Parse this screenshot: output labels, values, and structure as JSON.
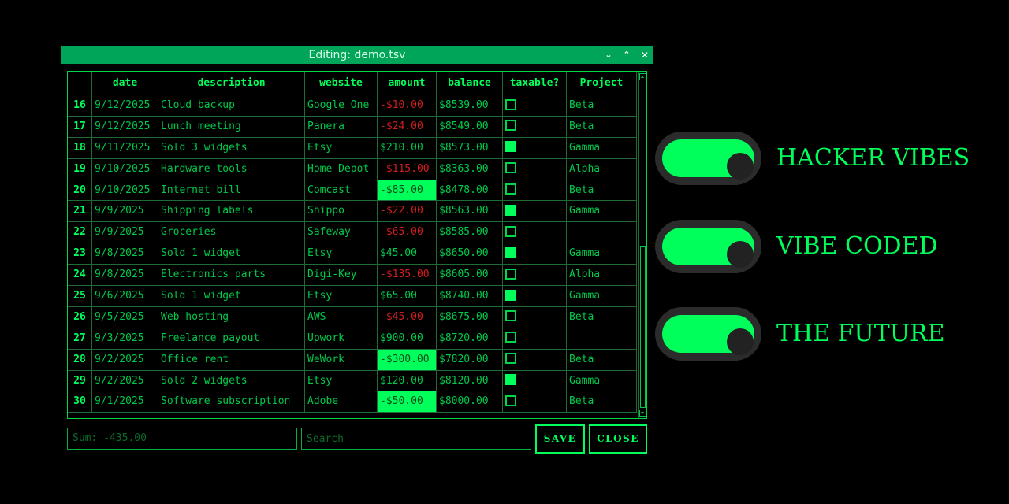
{
  "window": {
    "title": "Editing: demo.tsv",
    "buttons": {
      "minimize": "⌄",
      "maximize": "⌃",
      "close": "✕"
    }
  },
  "table": {
    "columns": [
      "",
      "date",
      "description",
      "website",
      "amount",
      "balance",
      "taxable?",
      "Project"
    ],
    "rows": [
      {
        "n": "16",
        "date": "9/12/2025",
        "description": "Cloud backup",
        "website": "Google One",
        "amount": "-$10.00",
        "balance": "$8539.00",
        "taxable": false,
        "project": "Beta",
        "neg": true,
        "hl": false
      },
      {
        "n": "17",
        "date": "9/12/2025",
        "description": "Lunch meeting",
        "website": "Panera",
        "amount": "-$24.00",
        "balance": "$8549.00",
        "taxable": false,
        "project": "Beta",
        "neg": true,
        "hl": false
      },
      {
        "n": "18",
        "date": "9/11/2025",
        "description": "Sold 3 widgets",
        "website": "Etsy",
        "amount": "$210.00",
        "balance": "$8573.00",
        "taxable": true,
        "project": "Gamma",
        "neg": false,
        "hl": false
      },
      {
        "n": "19",
        "date": "9/10/2025",
        "description": "Hardware tools",
        "website": "Home Depot",
        "amount": "-$115.00",
        "balance": "$8363.00",
        "taxable": false,
        "project": "Alpha",
        "neg": true,
        "hl": false
      },
      {
        "n": "20",
        "date": "9/10/2025",
        "description": "Internet bill",
        "website": "Comcast",
        "amount": "-$85.00",
        "balance": "$8478.00",
        "taxable": false,
        "project": "Beta",
        "neg": true,
        "hl": true
      },
      {
        "n": "21",
        "date": "9/9/2025",
        "description": "Shipping labels",
        "website": "Shippo",
        "amount": "-$22.00",
        "balance": "$8563.00",
        "taxable": true,
        "project": "Gamma",
        "neg": true,
        "hl": false
      },
      {
        "n": "22",
        "date": "9/9/2025",
        "description": "Groceries",
        "website": "Safeway",
        "amount": "-$65.00",
        "balance": "$8585.00",
        "taxable": false,
        "project": "",
        "neg": true,
        "hl": false
      },
      {
        "n": "23",
        "date": "9/8/2025",
        "description": "Sold 1 widget",
        "website": "Etsy",
        "amount": "$45.00",
        "balance": "$8650.00",
        "taxable": true,
        "project": "Gamma",
        "neg": false,
        "hl": false
      },
      {
        "n": "24",
        "date": "9/8/2025",
        "description": "Electronics parts",
        "website": "Digi-Key",
        "amount": "-$135.00",
        "balance": "$8605.00",
        "taxable": false,
        "project": "Alpha",
        "neg": true,
        "hl": false
      },
      {
        "n": "25",
        "date": "9/6/2025",
        "description": "Sold 1 widget",
        "website": "Etsy",
        "amount": "$65.00",
        "balance": "$8740.00",
        "taxable": true,
        "project": "Gamma",
        "neg": false,
        "hl": false
      },
      {
        "n": "26",
        "date": "9/5/2025",
        "description": "Web hosting",
        "website": "AWS",
        "amount": "-$45.00",
        "balance": "$8675.00",
        "taxable": false,
        "project": "Beta",
        "neg": true,
        "hl": false
      },
      {
        "n": "27",
        "date": "9/3/2025",
        "description": "Freelance payout",
        "website": "Upwork",
        "amount": "$900.00",
        "balance": "$8720.00",
        "taxable": false,
        "project": "",
        "neg": false,
        "hl": false
      },
      {
        "n": "28",
        "date": "9/2/2025",
        "description": "Office rent",
        "website": "WeWork",
        "amount": "-$300.00",
        "balance": "$7820.00",
        "taxable": false,
        "project": "Beta",
        "neg": true,
        "hl": true
      },
      {
        "n": "29",
        "date": "9/2/2025",
        "description": "Sold 2 widgets",
        "website": "Etsy",
        "amount": "$120.00",
        "balance": "$8120.00",
        "taxable": true,
        "project": "Gamma",
        "neg": false,
        "hl": false
      },
      {
        "n": "30",
        "date": "9/1/2025",
        "description": "Software subscription",
        "website": "Adobe",
        "amount": "-$50.00",
        "balance": "$8000.00",
        "taxable": false,
        "project": "Beta",
        "neg": true,
        "hl": true
      }
    ]
  },
  "footer": {
    "sum": "Sum: -435.00",
    "search_placeholder": "Search",
    "save_label": "SAVE",
    "close_label": "CLOSE"
  },
  "toggles": [
    {
      "label": "HACKER VIBES",
      "on": true
    },
    {
      "label": "VIBE CODED",
      "on": true
    },
    {
      "label": "THE FUTURE",
      "on": true
    }
  ],
  "colors": {
    "accent": "#00ff5a",
    "titlebar": "#00a55a",
    "negative": "#d21e1e",
    "background": "#000000"
  }
}
